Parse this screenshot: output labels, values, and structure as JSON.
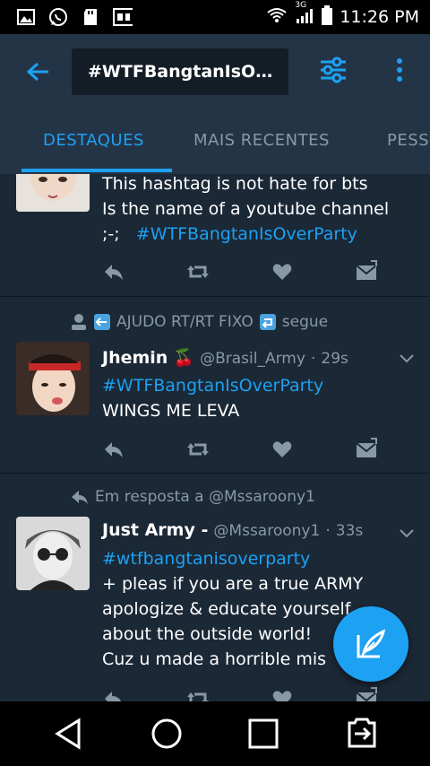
{
  "status_bar": {
    "time": "11:26 PM",
    "network": "3G",
    "icons": [
      "gallery-icon",
      "whatsapp-icon",
      "sd-card-icon",
      "vpn-icon",
      "wifi-icon",
      "signal-icon",
      "battery-icon"
    ]
  },
  "app_bar": {
    "search_query": "#WTFBangtanIsO…",
    "icons": [
      "back-arrow-icon",
      "filter-icon",
      "more-vert-icon"
    ]
  },
  "tabs": [
    {
      "label": "DESTAQUES",
      "active": true
    },
    {
      "label": "MAIS RECENTES",
      "active": false
    },
    {
      "label": "PESS",
      "active": false
    }
  ],
  "tweets": [
    {
      "lines": [
        "This hashtag is not hate for bts",
        "Is the name of a youtube channel"
      ],
      "prefix": ";-;",
      "hashtag": "#WTFBangtanIsOverParty"
    },
    {
      "context_text": "AJUDO RT/RT FIXO",
      "context_suffix": "segue",
      "name": "Jhemin",
      "emoji": "🍒",
      "handle": "@Brasil_Army",
      "time": "29s",
      "hashtag": "#WTFBangtanIsOverParty",
      "text": "WINGS ME LEVA"
    },
    {
      "reply_to": "Em resposta a @Mssaroony1",
      "name": "Just Army -",
      "handle": "@Mssaroony1",
      "time": "33s",
      "hashtag": "#wtfbangtanisoverparty",
      "lines": [
        "+ pleas if you are a true ARMY",
        "apologize & educate yourself",
        "about the outside world!",
        "Cuz u made a horrible mis"
      ]
    }
  ],
  "separator": "·",
  "colors": {
    "accent": "#1da1f2",
    "background": "#1b2836",
    "appbar": "#243447",
    "muted": "#8899a6"
  }
}
